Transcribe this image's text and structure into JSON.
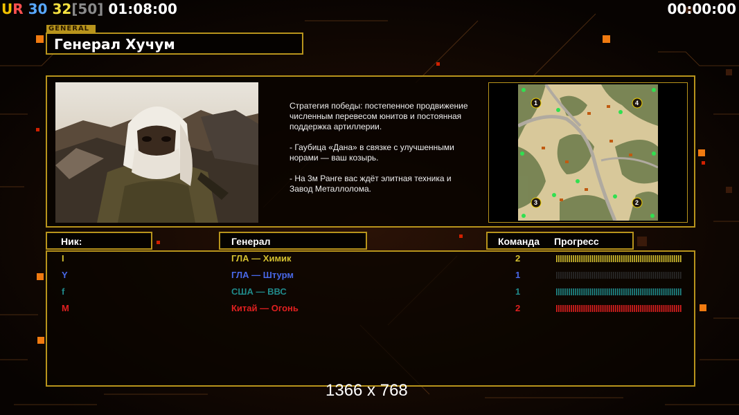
{
  "hud": {
    "ur_u": "U",
    "ur_r": "R",
    "v1": "30",
    "v2": "32",
    "v3": "[50]",
    "game_time": "01:08:00",
    "timer": "00:00:00"
  },
  "general_tag": "GENERAL",
  "general_name": "Генерал Хучум",
  "description": {
    "p1": "Стратегия победы: постепенное продвижение численным перевесом юнитов и постоянная поддержка артиллерии.",
    "p2": "- Гаубица «Дана» в связке с улучшенными норами — ваш козырь.",
    "p3": "- На 3м Ранге вас ждёт элитная техника и Завод Металлолома."
  },
  "map": {
    "start_positions": [
      "1",
      "2",
      "3",
      "4"
    ]
  },
  "table": {
    "col_nick": "Ник:",
    "col_general": "Генерал",
    "col_team": "Команда",
    "col_progress": "Прогресс",
    "rows": [
      {
        "nick": "I",
        "general": "ГЛА — Химик",
        "team": "2",
        "color": "#d4c030",
        "progress": 1.0
      },
      {
        "nick": "Y",
        "general": "ГЛА — Штурм",
        "team": "1",
        "color": "#4868e8",
        "progress": 0.0
      },
      {
        "nick": "f",
        "general": "США — ВВС",
        "team": "1",
        "color": "#208a8a",
        "progress": 1.0
      },
      {
        "nick": "M",
        "general": "Китай — Огонь",
        "team": "2",
        "color": "#e02020",
        "progress": 1.0
      }
    ]
  },
  "resolution": "1366 x 768"
}
